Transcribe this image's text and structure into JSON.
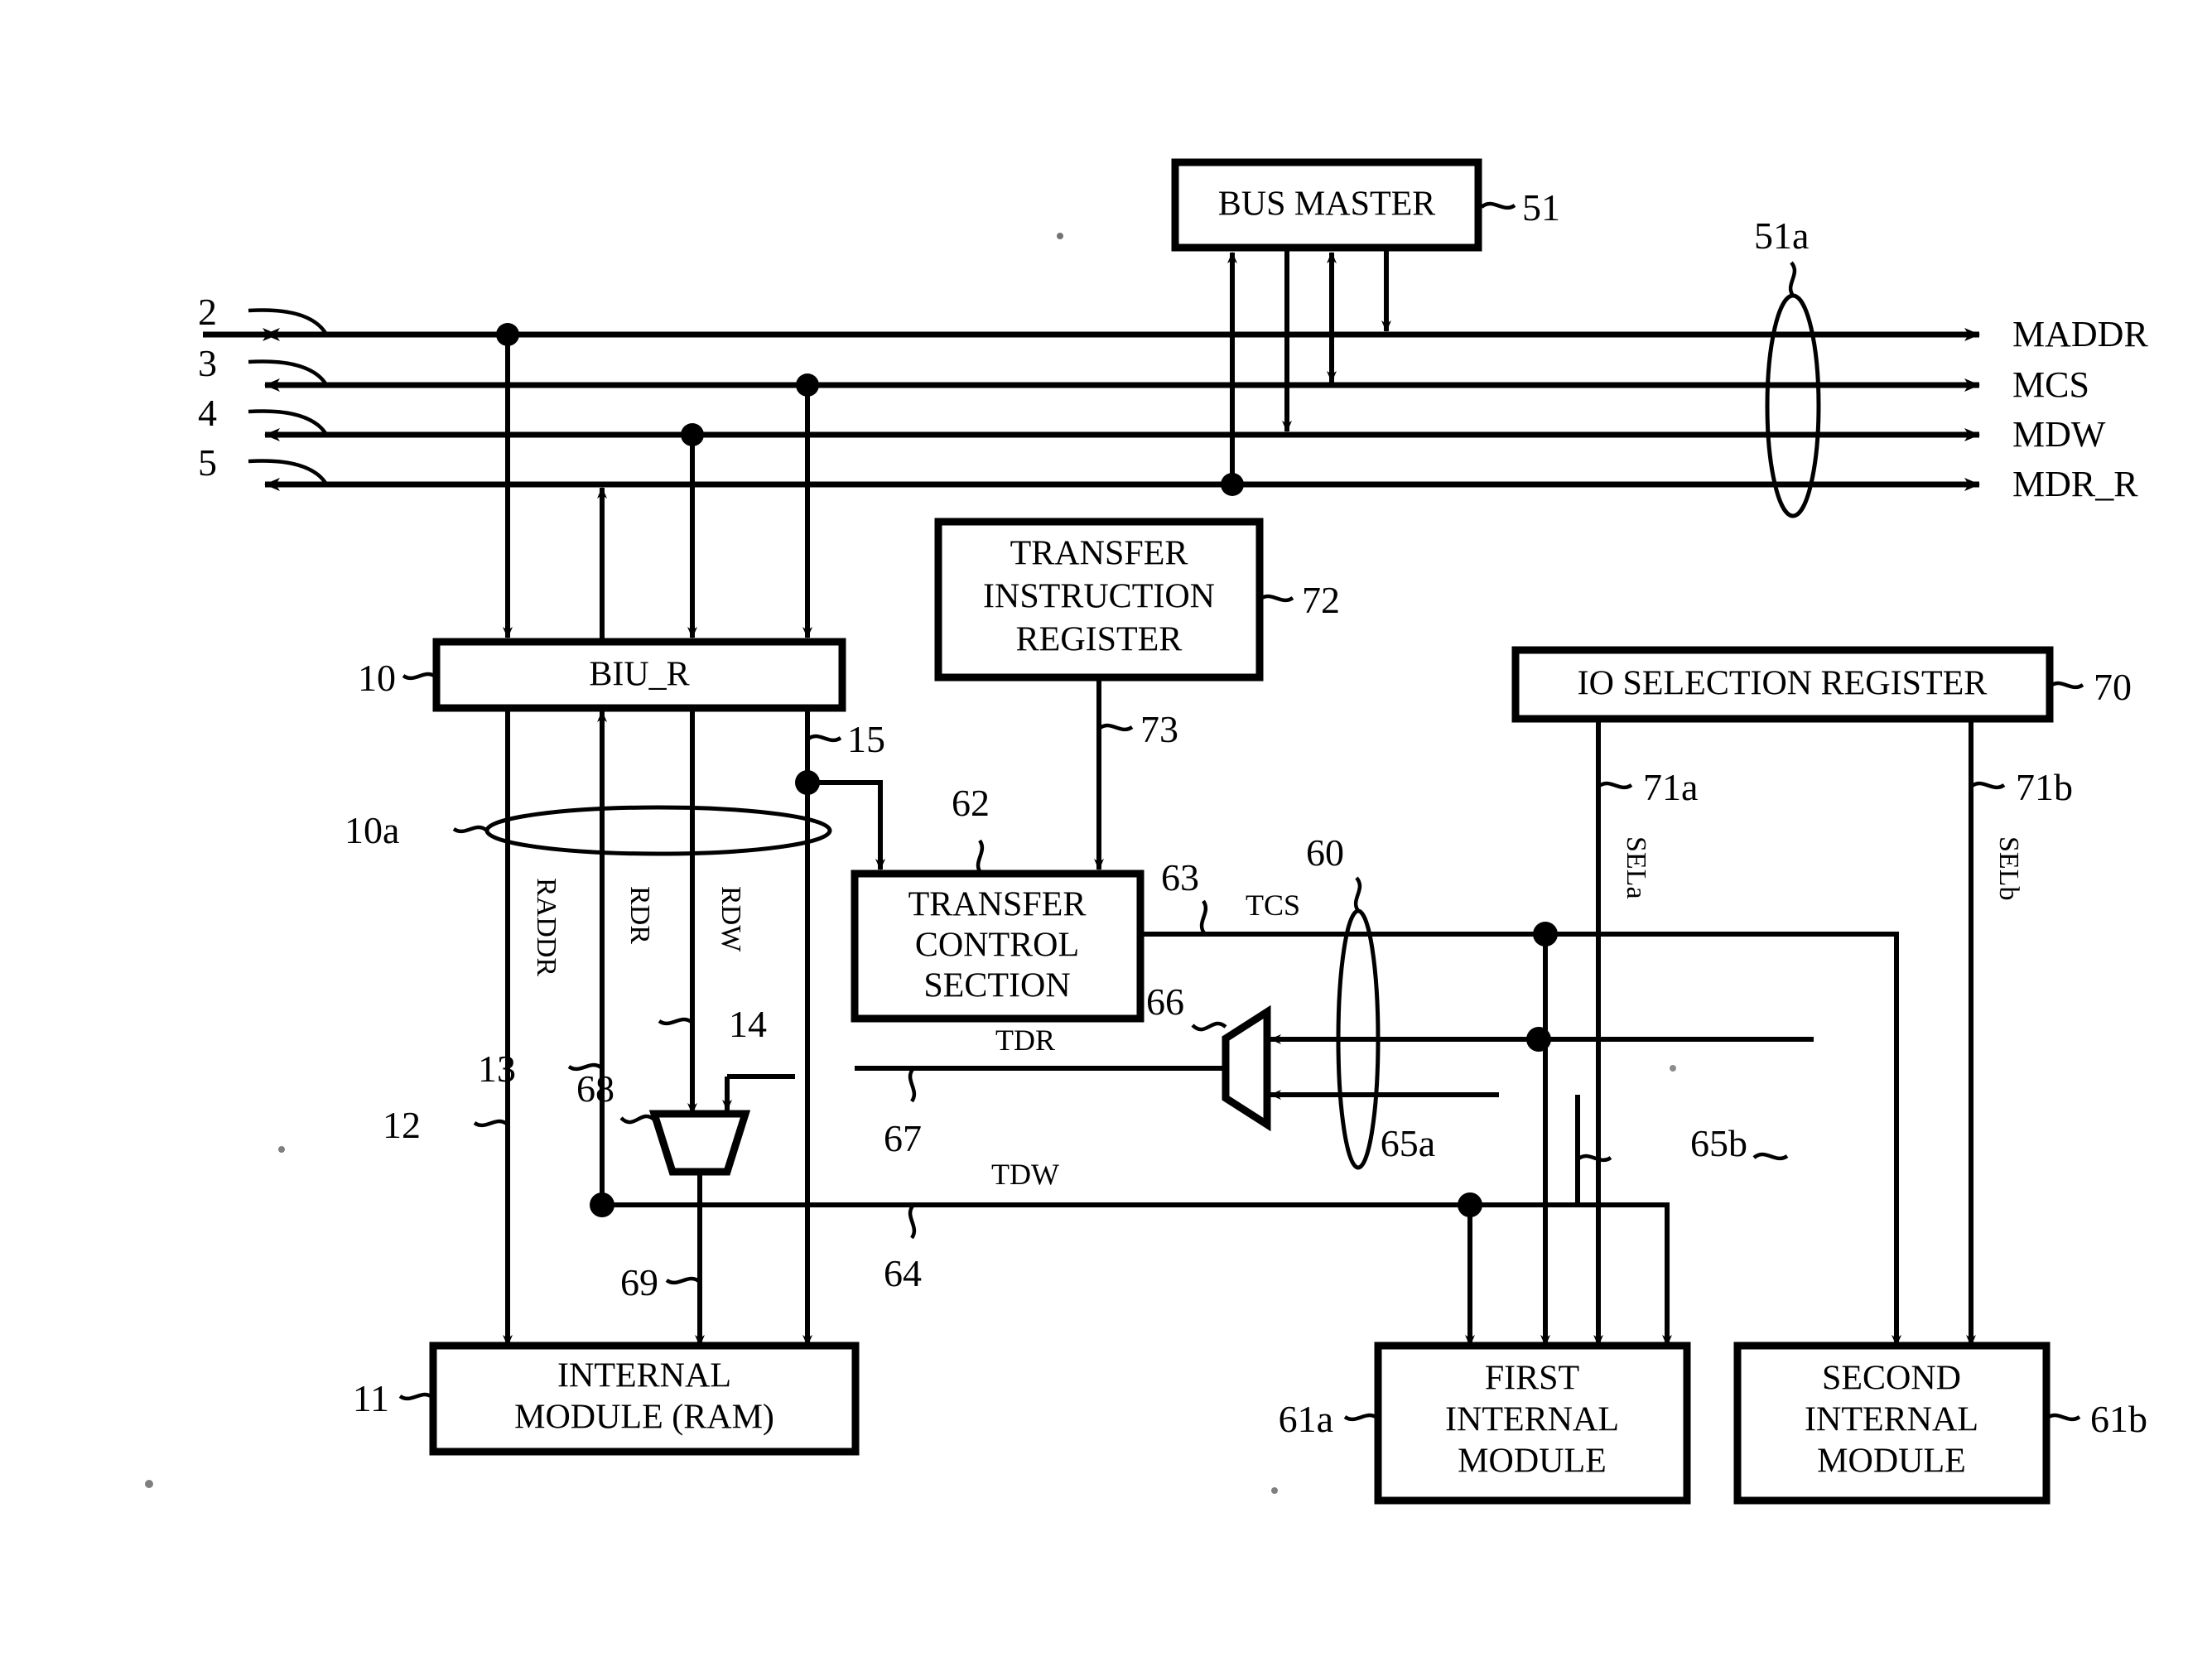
{
  "diagram": {
    "type": "patent-block-diagram",
    "blocks": {
      "bus_master": {
        "label": "BUS MASTER",
        "ref": "51"
      },
      "biu_r": {
        "label": "BIU_R",
        "ref": "10"
      },
      "transfer_instruction_register": {
        "label_line1": "TRANSFER",
        "label_line2": "INSTRUCTION",
        "label_line3": "REGISTER",
        "ref": "72"
      },
      "io_selection_register": {
        "label": "IO SELECTION REGISTER",
        "ref": "70"
      },
      "transfer_control_section": {
        "label_line1": "TRANSFER",
        "label_line2": "CONTROL",
        "label_line3": "SECTION",
        "ref": "62"
      },
      "internal_module_ram": {
        "label_line1": "INTERNAL",
        "label_line2": "MODULE (RAM)",
        "ref": "11"
      },
      "first_internal_module": {
        "label_line1": "FIRST",
        "label_line2": "INTERNAL",
        "label_line3": "MODULE",
        "ref": "61a"
      },
      "second_internal_module": {
        "label_line1": "SECOND",
        "label_line2": "INTERNAL",
        "label_line3": "MODULE",
        "ref": "61b"
      },
      "mux_tdr": {
        "ref": "66"
      },
      "mux_rdw": {
        "ref": "68"
      }
    },
    "bus_signals": [
      {
        "left_ref": "2",
        "name": "MADDR"
      },
      {
        "left_ref": "3",
        "name": "MCS"
      },
      {
        "left_ref": "4",
        "name": "MDW"
      },
      {
        "left_ref": "5",
        "name": "MDR_R"
      }
    ],
    "bundle_refs": {
      "external_bus": "51a",
      "internal_bus": "10a",
      "module_bus": "60"
    },
    "signal_labels": {
      "raddr": "RADDR",
      "rdr": "RDR",
      "rdw": "RDW",
      "tcs": "TCS",
      "tdr": "TDR",
      "tdw": "TDW",
      "sela": "SELa",
      "selb": "SELb"
    },
    "wire_refs": {
      "raddr_line": "12",
      "rdr_line": "13",
      "rdw_line": "14",
      "biu_out4": "15",
      "tcs_line": "63",
      "tdw_line": "64",
      "tdw_branch_a": "65a",
      "tdw_branch_b": "65b",
      "tdr_line": "67",
      "mux_out_ram": "69",
      "sela_line": "71a",
      "selb_line": "71b",
      "tir_out": "73"
    }
  }
}
